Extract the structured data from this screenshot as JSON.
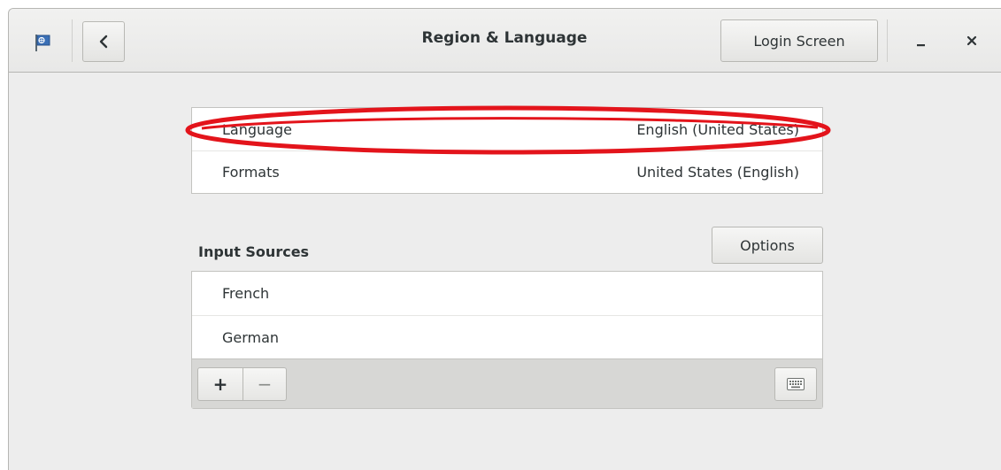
{
  "window": {
    "title": "Region & Language",
    "login_button": "Login Screen"
  },
  "icons": {
    "app": "flag-icon",
    "back": "chevron-left-icon",
    "minimize": "minimize-icon",
    "close": "close-icon",
    "add": "plus-icon",
    "remove": "minus-icon",
    "keyboard": "keyboard-icon"
  },
  "language_section": {
    "rows": [
      {
        "label": "Language",
        "value": "English (United States)",
        "highlighted": true
      },
      {
        "label": "Formats",
        "value": "United States (English)",
        "highlighted": false
      }
    ]
  },
  "input_sources": {
    "title": "Input Sources",
    "options_button": "Options",
    "items": [
      "French",
      "German"
    ],
    "add_label": "+",
    "remove_label": "−"
  },
  "colors": {
    "highlight": "#e3141b",
    "background": "#ededed",
    "text": "#2e3436"
  }
}
